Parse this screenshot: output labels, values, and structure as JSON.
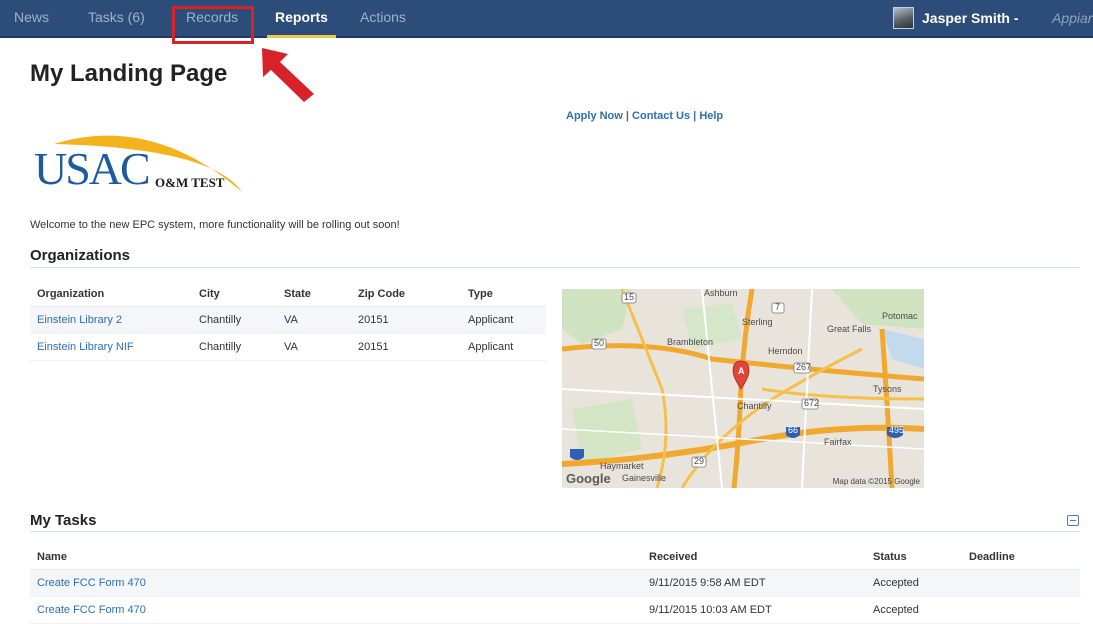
{
  "nav": {
    "items": [
      {
        "label": "News"
      },
      {
        "label": "Tasks (6)"
      },
      {
        "label": "Records"
      },
      {
        "label": "Reports"
      },
      {
        "label": "Actions"
      }
    ],
    "active": "Reports",
    "highlighted": "Records",
    "user_name": "Jasper Smith -",
    "app_name": "Appian"
  },
  "page": {
    "title": "My Landing Page",
    "links": [
      "Apply Now",
      "Contact Us",
      "Help"
    ],
    "link_separator": "|",
    "logo_text": "USAC",
    "logo_subtext": "O&M TEST",
    "welcome": "Welcome to the new EPC system, more functionality will be rolling out soon!"
  },
  "organizations": {
    "title": "Organizations",
    "columns": [
      "Organization",
      "City",
      "State",
      "Zip Code",
      "Type"
    ],
    "rows": [
      [
        "Einstein Library 2",
        "Chantilly",
        "VA",
        "20151",
        "Applicant"
      ],
      [
        "Einstein Library NIF",
        "Chantilly",
        "VA",
        "20151",
        "Applicant"
      ]
    ]
  },
  "map": {
    "labels": [
      "Ashburn",
      "Potomac",
      "Sterling",
      "Great Falls",
      "Brambleton",
      "Herndon",
      "Tysons",
      "Chantilly",
      "Fairfax",
      "Haymarket",
      "Gainesville"
    ],
    "route_shields": [
      "15",
      "7",
      "50",
      "267",
      "672",
      "66",
      "495",
      "29"
    ],
    "marker": "A",
    "google": "Google",
    "credit": "Map data ©2015 Google"
  },
  "tasks": {
    "title": "My Tasks",
    "columns": [
      "Name",
      "Received",
      "Status",
      "Deadline"
    ],
    "rows": [
      [
        "Create FCC Form 470",
        "9/11/2015 9:58 AM EDT",
        "Accepted",
        ""
      ],
      [
        "Create FCC Form 470",
        "9/11/2015 10:03 AM EDT",
        "Accepted",
        ""
      ]
    ]
  },
  "colors": {
    "nav_background": "#2c4c79",
    "active_underline": "#e8c94a",
    "link": "#2f6db0",
    "logo_blue": "#1c5b9e",
    "logo_swoosh": "#f2b31c",
    "annotation_red": "#d8222a"
  }
}
